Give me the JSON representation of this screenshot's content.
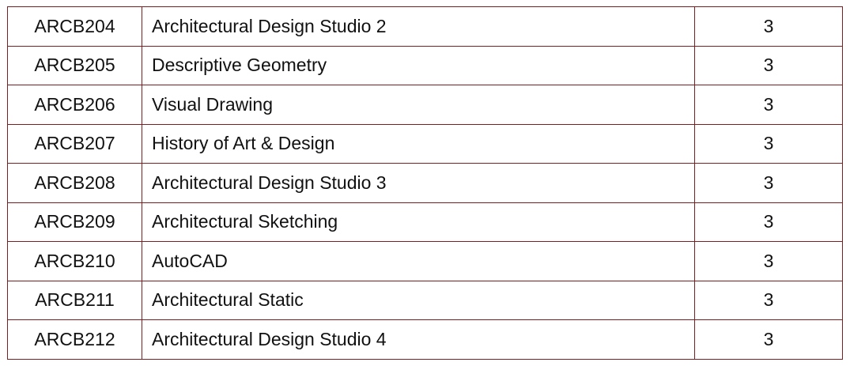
{
  "courses": [
    {
      "code": "ARCB204",
      "name": "Architectural Design Studio 2",
      "credits": "3"
    },
    {
      "code": "ARCB205",
      "name": "Descriptive Geometry",
      "credits": "3"
    },
    {
      "code": "ARCB206",
      "name": "Visual Drawing",
      "credits": "3"
    },
    {
      "code": "ARCB207",
      "name": "History of Art & Design",
      "credits": "3"
    },
    {
      "code": "ARCB208",
      "name": "Architectural Design Studio 3",
      "credits": "3"
    },
    {
      "code": "ARCB209",
      "name": "Architectural Sketching",
      "credits": "3"
    },
    {
      "code": "ARCB210",
      "name": "AutoCAD",
      "credits": "3"
    },
    {
      "code": "ARCB211",
      "name": "Architectural Static",
      "credits": "3"
    },
    {
      "code": "ARCB212",
      "name": "Architectural Design Studio 4",
      "credits": "3"
    }
  ],
  "colors": {
    "border": "#7a1f22",
    "text": "#111111",
    "background": "#ffffff"
  }
}
